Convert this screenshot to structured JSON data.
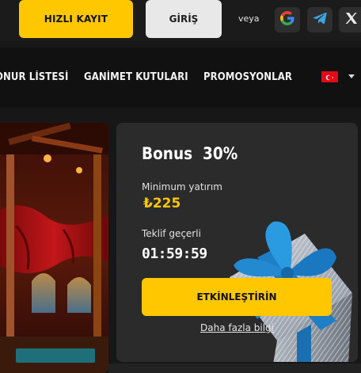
{
  "header": {
    "register_label": "HIZLI KAYIT",
    "login_label": "GİRİŞ",
    "or_label": "veya",
    "social": [
      {
        "icon": "google-icon"
      },
      {
        "icon": "telegram-icon"
      },
      {
        "icon": "x-icon"
      }
    ]
  },
  "nav": {
    "items": [
      {
        "label": "ONUR LİSTESİ"
      },
      {
        "label": "GANİMET KUTULARI"
      },
      {
        "label": "PROMOSYONLAR"
      }
    ],
    "language_flag": "turkey-flag-icon"
  },
  "bonus": {
    "title": "Bonus",
    "percent": "30%",
    "min_deposit_label": "Minimum yatırım",
    "min_deposit_value": "₺225",
    "offer_valid_label": "Teklif geçerli",
    "countdown": "01:59:59",
    "activate_label": "ETKİNLEŞTİRİN",
    "more_info_label": "Daha fazla bilgi"
  },
  "colors": {
    "accent": "#ffc700",
    "background": "#181818",
    "card": "#2b2b2b"
  }
}
